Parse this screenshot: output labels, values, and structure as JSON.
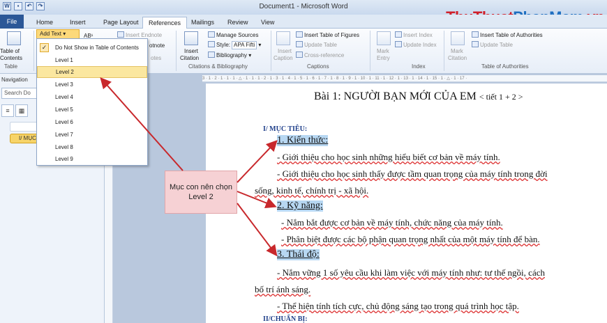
{
  "window": {
    "title": "Document1 - Microsoft Word",
    "brand": {
      "part1": "ThuThuat",
      "part2": "PhanMem",
      "part3": ".vn"
    }
  },
  "tabs": [
    "File",
    "Home",
    "Insert",
    "Page Layout",
    "References",
    "Mailings",
    "Review",
    "View"
  ],
  "ribbon": {
    "toc": {
      "label1": "Table of",
      "label2": "Contents",
      "group": "Table"
    },
    "add_text": "Add Text",
    "footnotes": {
      "insert_endnote": "Insert Endnote",
      "footnote": "otnote",
      "notes": "otes"
    },
    "citations": {
      "insert_citation1": "Insert",
      "insert_citation2": "Citation",
      "manage_sources": "Manage Sources",
      "style_label": "Style:",
      "style_value": "APA Fifti",
      "bibliography": "Bibliography",
      "group": "Citations & Bibliography"
    },
    "captions": {
      "insert_caption1": "Insert",
      "insert_caption2": "Caption",
      "insert_tof": "Insert Table of Figures",
      "update_table": "Update Table",
      "cross_reference": "Cross-reference",
      "group": "Captions"
    },
    "index": {
      "mark_entry1": "Mark",
      "mark_entry2": "Entry",
      "insert_index": "Insert Index",
      "update_index": "Update Index",
      "group": "Index"
    },
    "toa": {
      "mark_citation1": "Mark",
      "mark_citation2": "Citation",
      "insert_toa": "Insert Table of Authorities",
      "update_table": "Update Table",
      "group": "Table of Authorities"
    }
  },
  "add_text_menu": {
    "items": [
      "Do Not Show in Table of Contents",
      "Level 1",
      "Level 2",
      "Level 3",
      "Level 4",
      "Level 5",
      "Level 6",
      "Level 7",
      "Level 8",
      "Level 9"
    ],
    "highlighted": "Level 2",
    "checked": "Do Not Show in Table of Contents"
  },
  "nav_pane": {
    "title": "Navigation",
    "search_placeholder": "Search Do",
    "heading": "I/ MỤC"
  },
  "ruler_text": "3 · 1 · 2 · 1 · 1 · 1 · △ · 1 · 1 · 1 · 2 · 1 · 3 · 1 · 4 · 1 · 5 · 1 · 6 · 1 · 7 · 1 · 8 · 1 · 9 · 1 · 10 · 1 · 11 · 1 · 12 · 1 · 13 · 1 · 14 · 1 · 15 · 1 · △ · 1 · 17 ·",
  "document": {
    "title": "Bài 1: NGƯỜI BẠN MỚI CỦA EM",
    "title_suffix": "< tiết 1 + 2 >",
    "section1": "I/ MỤC TIÊU:",
    "heading_knowledge": "1. Kiến thức:",
    "line1": "- Giới thiệu cho học sinh những hiểu biết cơ bản về máy tính.",
    "line2a": "- Giới thiệu cho học sinh thấy được tầm quan trọng của máy tính trong đời",
    "line2b": "sống, kinh tế, chính trị - xã hội.",
    "heading_skills": "2. Kỹ năng:",
    "line3": "- Nắm bắt được cơ bản về máy tính, chức năng của máy tính.",
    "line4": "- Phân biệt được các bộ phận quan trọng nhất của một máy tính để bàn.",
    "heading_attitude": "3. Thái độ:",
    "line5a": "- Nắm vững 1 số yêu cầu khi làm việc với máy tính  như: tư thế ngồi, cách",
    "line5b": "bố trí ánh sáng.",
    "line6": "- Thể hiện tính tích cực,  chủ động sáng tạo trong quá trình học tập.",
    "section2": "II/CHUẨN BỊ:"
  },
  "callout": {
    "line1": "Mục con nên chọn",
    "line2": "Level 2"
  },
  "colors": {
    "brand_red": "#d0202a",
    "brand_blue": "#1f6fc0",
    "arrow": "#c8282c",
    "highlight_blue": "#b7d7f2"
  }
}
